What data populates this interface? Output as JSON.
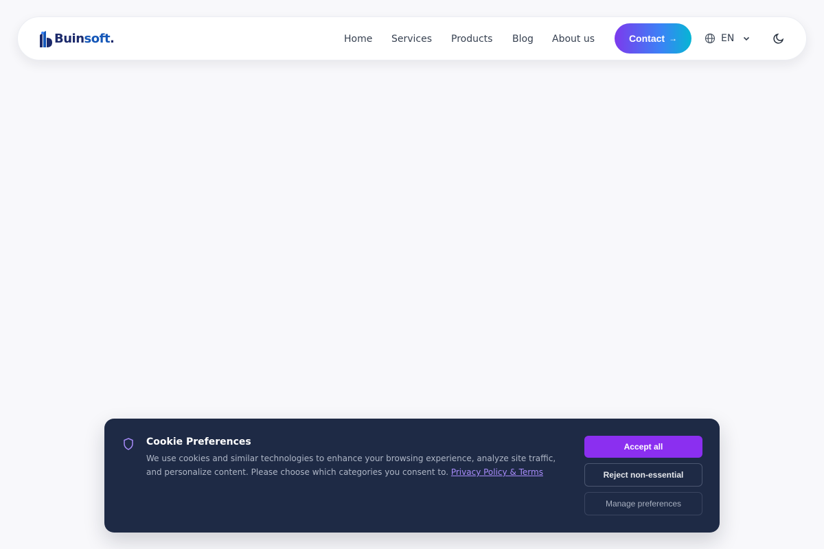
{
  "brand": {
    "name_part1": "Buin",
    "name_part2": "soft",
    "name_dot": "."
  },
  "nav": {
    "links": [
      "Home",
      "Services",
      "Products",
      "Blog",
      "About us"
    ],
    "contact_label": "Contact",
    "contact_arrow": "→",
    "language": "EN"
  },
  "icons": {
    "language": "globe-icon",
    "language_dropdown": "chevron-down-icon",
    "theme": "moon-icon",
    "cookie": "shield-icon"
  },
  "cookie_banner": {
    "title": "Cookie Preferences",
    "description": "We use cookies and similar technologies to enhance your browsing experience, analyze site traffic, and personalize content. Please choose which categories you consent to.",
    "link_label": "Privacy Policy & Terms",
    "accept_label": "Accept all",
    "reject_label": "Reject non-essential",
    "manage_label": "Manage preferences"
  },
  "colors": {
    "accent": "#8b2ff0",
    "banner_bg": "#1e2a45",
    "link": "#a78bfa",
    "contact_gradient": [
      "#7c3aed",
      "#3b82f6",
      "#06b6d4"
    ]
  }
}
